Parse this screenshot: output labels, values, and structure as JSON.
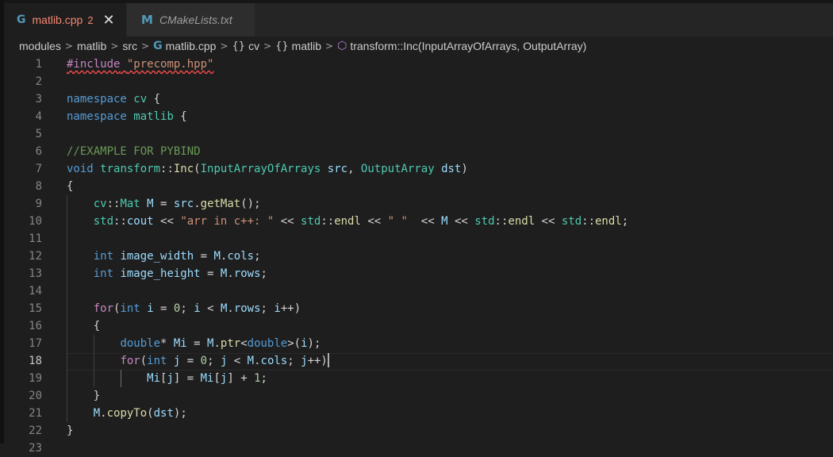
{
  "tabs": [
    {
      "icon": "G",
      "label": "matlib.cpp",
      "badge": "2",
      "close": "✕"
    },
    {
      "icon": "M",
      "label": "CMakeLists.txt"
    }
  ],
  "breadcrumb": {
    "items": [
      "modules",
      "matlib",
      "src",
      "matlib.cpp",
      "cv",
      "matlib",
      "transform::Inc(InputArrayOfArrays, OutputArray)"
    ],
    "icons": {
      "file": "G",
      "namespace": "{}",
      "method": "⬡"
    }
  },
  "editor": {
    "line_numbers": [
      "1",
      "2",
      "3",
      "4",
      "5",
      "6",
      "7",
      "8",
      "9",
      "10",
      "11",
      "12",
      "13",
      "14",
      "15",
      "16",
      "17",
      "18",
      "19",
      "20",
      "21",
      "22",
      "23"
    ],
    "current_line": "18"
  },
  "colors": {
    "keyword": "#569cd6",
    "control": "#c586c0",
    "type": "#4ec9b0",
    "function": "#dcdcaa",
    "variable": "#9cdcfe",
    "string": "#ce9178",
    "number": "#b5cea8",
    "comment": "#6a9955"
  }
}
